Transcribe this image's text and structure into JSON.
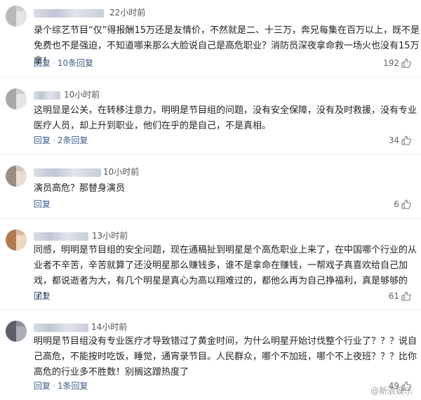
{
  "comments": [
    {
      "time": "22小时前",
      "text": "录个综艺节目“仅”得报酬15万还是友情价，不然就是二、十三万，奔兄每集在百万以上，既不是免费也不是强迫，不知道哪来那么大脸说自己是高危职业？消防员深夜拿命救一场火也没有15万拿！",
      "reply": "回复",
      "sub_replies": "10条回复",
      "likes": "192"
    },
    {
      "time": "10小时前",
      "text": "这明显是公关，在转移注意力，明明是节目组的问题，没有安全保障，没有及时救援，没有专业医疗人员，却上升到职业，他们在乎的是自己，不是真相。",
      "reply": "回复",
      "sub_replies": "2条回复",
      "likes": "34"
    },
    {
      "time": "10小时前",
      "text": "演员高危？那替身演员",
      "reply": "回复",
      "sub_replies": "",
      "likes": "6"
    },
    {
      "time": "13小时前",
      "text": "同感，明明是节目组的安全问题，现在通稿扯到明星是个高危职业上来了，在中国哪个行业的从业者不辛苦，辛苦就算了还没明星那么赚钱多，谁不是拿命在赚钱，一帮戏子真喜欢给自己加戏，都说逝者为大，有几个明星是真心为高以翔难过的，都他么再为自己挣福利，真是够够的了！",
      "reply": "回复",
      "sub_replies": "",
      "likes": "61"
    },
    {
      "time": "14小时前",
      "text": "明明是节目组没有专业医疗才导致错过了黄金时间，为什么明星开始讨伐整个行业了？？？说自己高危，不能按时吃饭，睡觉，通宵录节目。人民群众，哪个不加班，哪个不上夜班？？？比你高危的行业多不胜数！别搁这蹭热度了",
      "reply": "回复",
      "sub_replies": "1条回复",
      "likes": "49"
    }
  ],
  "watermark": "@新浪娱乐",
  "colors": {
    "link": "#3e5f8a",
    "text": "#222222",
    "meta": "#555555"
  }
}
